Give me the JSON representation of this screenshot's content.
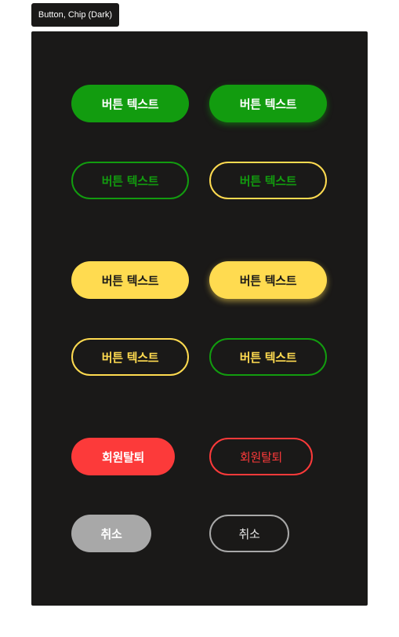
{
  "frame": {
    "label": "Button, Chip (Dark)"
  },
  "colors": {
    "background": "#1a1918",
    "green": "#129c0f",
    "yellow": "#ffdb50",
    "red": "#fc3a3a",
    "gray": "#a8a8a8"
  },
  "buttons": {
    "primary_green": "버튼 텍스트",
    "primary_green_hover": "버튼 텍스트",
    "outline_green": "버튼 텍스트",
    "outline_green_focus": "버튼 텍스트",
    "primary_yellow": "버튼 텍스트",
    "primary_yellow_hover": "버튼 텍스트",
    "outline_yellow": "버튼 텍스트",
    "outline_yellow_focus": "버튼 텍스트",
    "withdraw_filled": "회원탈퇴",
    "withdraw_outline": "회원탈퇴",
    "cancel_filled": "취소",
    "cancel_outline": "취소"
  }
}
